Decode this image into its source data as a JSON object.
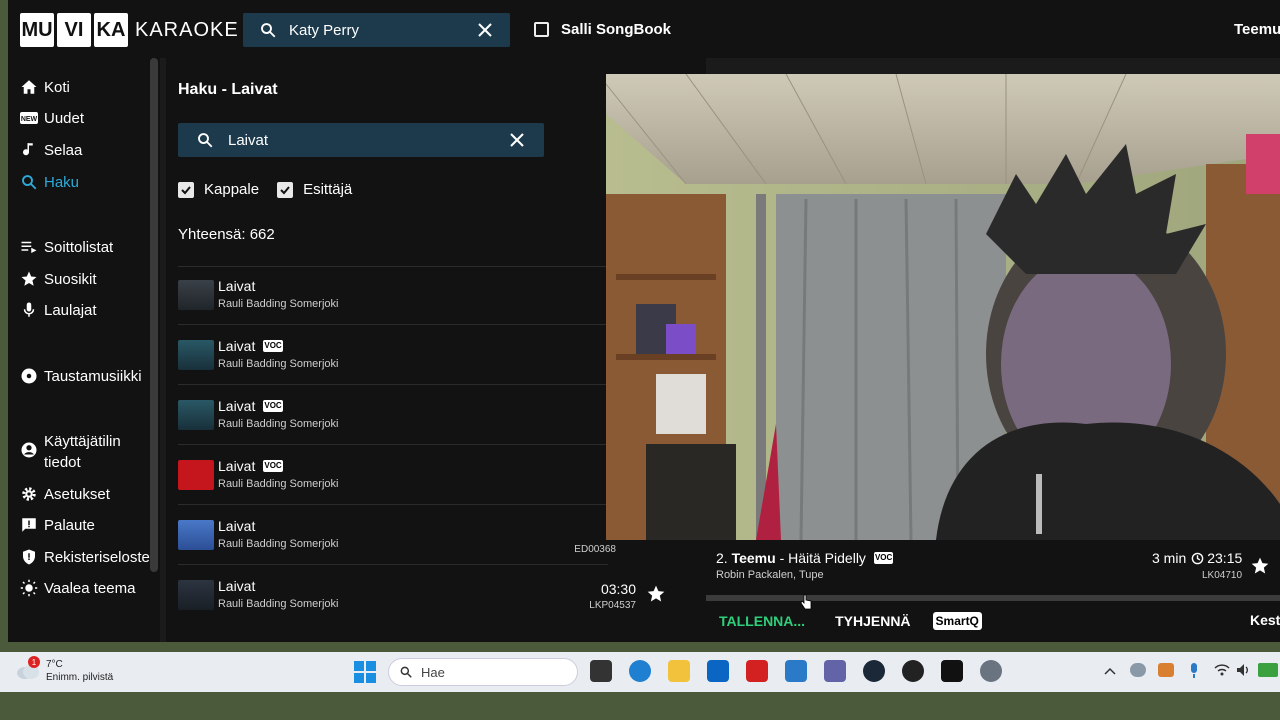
{
  "header": {
    "logo_parts": [
      "MU",
      "VI",
      "KA"
    ],
    "logo_word": "KARAOKE",
    "search_value": "Katy Perry",
    "songbook_label": "Salli SongBook",
    "user_name": "Teemu"
  },
  "sidebar": {
    "items": [
      {
        "label": "Koti",
        "icon": "home-icon"
      },
      {
        "label": "Uudet",
        "icon": "new-badge-icon"
      },
      {
        "label": "Selaa",
        "icon": "music-note-icon"
      },
      {
        "label": "Haku",
        "icon": "search-icon",
        "active": true
      },
      {
        "label": "Soittolistat",
        "icon": "playlist-icon"
      },
      {
        "label": "Suosikit",
        "icon": "star-icon"
      },
      {
        "label": "Laulajat",
        "icon": "microphone-icon"
      },
      {
        "label": "Taustamusiikki",
        "icon": "disc-icon"
      },
      {
        "label": "Käyttäjätilin",
        "label2": "tiedot",
        "icon": "account-icon"
      },
      {
        "label": "Asetukset",
        "icon": "gear-icon"
      },
      {
        "label": "Palaute",
        "icon": "feedback-icon"
      },
      {
        "label": "Rekisteriseloste",
        "icon": "shield-icon"
      },
      {
        "label": "Vaalea teema",
        "icon": "sun-icon"
      }
    ]
  },
  "results": {
    "title": "Haku - Laivat",
    "search_value": "Laivat",
    "filters": [
      {
        "label": "Kappale",
        "checked": true
      },
      {
        "label": "Esittäjä",
        "checked": true
      }
    ],
    "total": "Yhteensä: 662",
    "songs": [
      {
        "title": "Laivat",
        "artist": "Rauli Badding Somerjoki",
        "voc": false,
        "duration": "",
        "code": ""
      },
      {
        "title": "Laivat",
        "artist": "Rauli Badding Somerjoki",
        "voc": true,
        "duration": "",
        "code": ""
      },
      {
        "title": "Laivat",
        "artist": "Rauli Badding Somerjoki",
        "voc": true,
        "duration": "",
        "code": ""
      },
      {
        "title": "Laivat",
        "artist": "Rauli Badding Somerjoki",
        "voc": true,
        "duration": "",
        "code": ""
      },
      {
        "title": "Laivat",
        "artist": "Rauli Badding Somerjoki",
        "voc": false,
        "duration": "",
        "code": "ED00368"
      },
      {
        "title": "Laivat",
        "artist": "Rauli Badding Somerjoki",
        "voc": false,
        "duration": "03:30",
        "code": "LKP04537"
      }
    ],
    "voc_label": "VOC"
  },
  "queue": {
    "position": "2.",
    "singer": "Teemu",
    "song": "- Häitä Pidelly",
    "artist": "Robin Packalen, Tupe",
    "wait": "3 min",
    "time": "23:15",
    "code": "LK04710",
    "save_label": "TALLENNA...",
    "clear_label": "TYHJENNÄ",
    "smartq_label": "SmartQ",
    "kesto_label": "Kesto"
  },
  "taskbar": {
    "temperature": "7°C",
    "weather": "Enimm. pilvistä",
    "badge": "1",
    "search_placeholder": "Hae"
  },
  "colors": {
    "accent": "#2fa9d8",
    "search_bg": "#1c3a4c",
    "save_green": "#2ecf7a"
  }
}
